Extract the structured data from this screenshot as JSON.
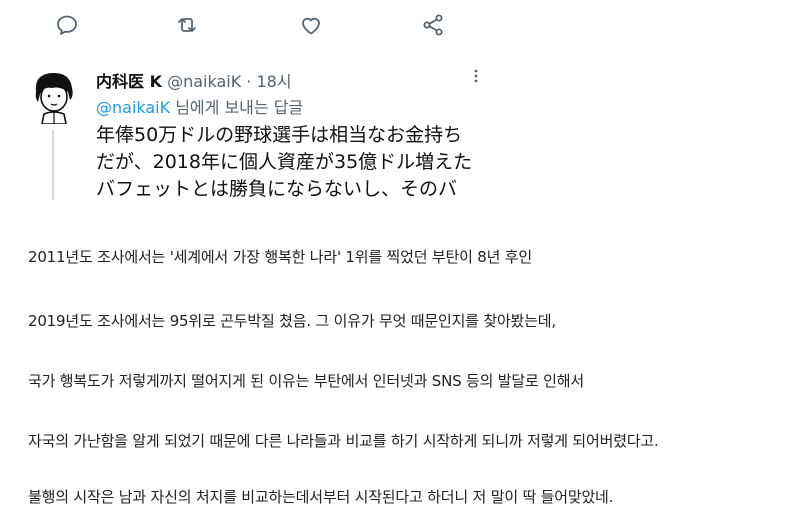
{
  "actions": [
    {
      "icon": "reply-icon"
    },
    {
      "icon": "retweet-icon"
    },
    {
      "icon": "like-icon"
    },
    {
      "icon": "share-icon"
    }
  ],
  "tweet": {
    "name": "内科医 K",
    "handle": "@naikaiK",
    "dot": "·",
    "time": "18시",
    "reply_mention": "@naikaiK",
    "reply_suffix": " 님에게 보내는 답글",
    "lines": [
      "年俸50万ドルの野球選手は相当なお金持ち",
      "だが、2018年に個人資産が35億ドル増えた",
      "バフェットとは勝負にならないし、そのバ"
    ]
  },
  "article": {
    "paragraphs": [
      "2011년도 조사에서는 '세계에서 가장 행복한 나라' 1위를 찍었던 부탄이 8년 후인",
      "2019년도 조사에서는 95위로 곤두박질 쳤음. 그 이유가 무엇 때문인지를 찾아봤는데,",
      "국가 행복도가 저렇게까지 떨어지게 된 이유는 부탄에서 인터넷과 SNS 등의 발달로 인해서",
      "자국의 가난함을 알게 되었기 때문에 다른 나라들과 비교를 하기 시작하게 되니까 저렇게 되어버렸다고.",
      "불행의 시작은 남과 자신의 처지를 비교하는데서부터 시작된다고 하더니 저 말이 딱 들어맞았네."
    ]
  }
}
